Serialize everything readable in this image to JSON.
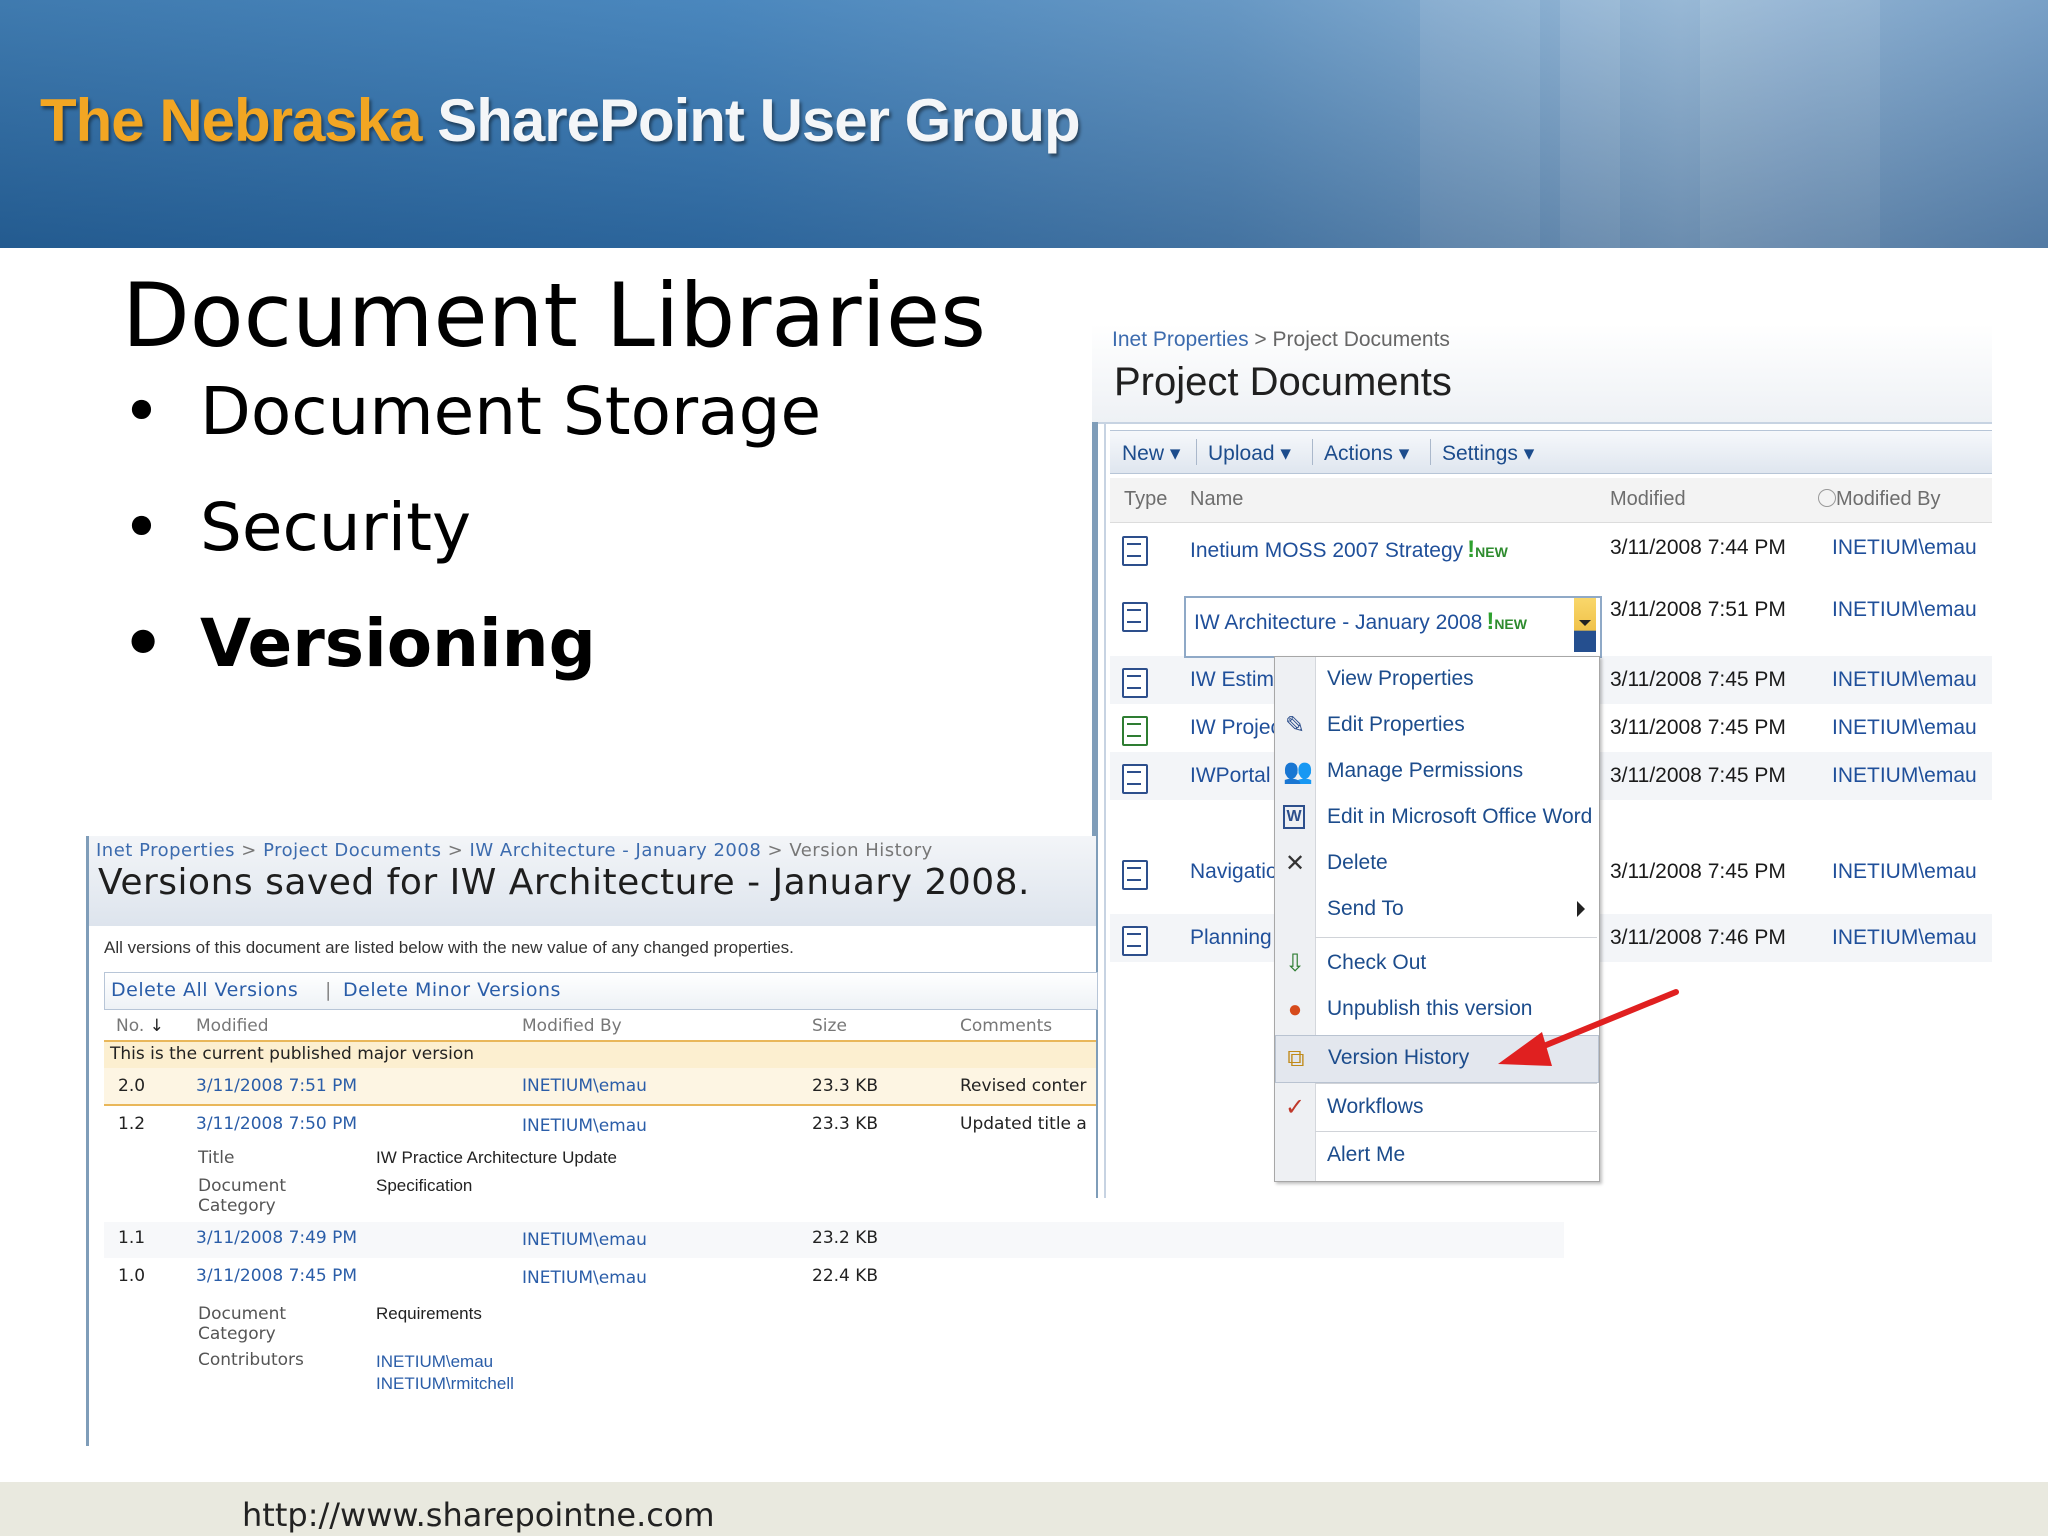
{
  "banner": {
    "title_orange": "The Nebraska",
    "title_white": "SharePoint User Group"
  },
  "slide": {
    "title": "Document Libraries",
    "bullets": [
      {
        "text": "Document Storage",
        "bold": false
      },
      {
        "text": "Security",
        "bold": false
      },
      {
        "text": "Versioning",
        "bold": true
      }
    ],
    "bullet_char": "•"
  },
  "library": {
    "breadcrumb": {
      "site": "Inet Properties",
      "sep": " > ",
      "page": "Project Documents"
    },
    "title": "Project Documents",
    "toolbar": [
      "New",
      "Upload",
      "Actions",
      "Settings"
    ],
    "columns": {
      "type": "Type",
      "name": "Name",
      "modified": "Modified",
      "modified_by": "Modified By"
    },
    "new_tag": "NEW",
    "rows": [
      {
        "name": "Inetium MOSS 2007 Strategy",
        "is_new": true,
        "modified": "3/11/2008 7:44 PM",
        "modified_by": "INETIUM\\emau",
        "icon": "word-doc-icon"
      },
      {
        "name": "IW Architecture - January 2008",
        "is_new": true,
        "modified": "3/11/2008 7:51 PM",
        "modified_by": "INETIUM\\emau",
        "icon": "word-doc-icon"
      },
      {
        "name": "IW Estima",
        "modified": "3/11/2008 7:45 PM",
        "modified_by": "INETIUM\\emau",
        "icon": "word-doc-icon"
      },
      {
        "name": "IW Projec",
        "modified": "3/11/2008 7:45 PM",
        "modified_by": "INETIUM\\emau",
        "icon": "excel-doc-icon"
      },
      {
        "name": "IWPortal",
        "modified": "3/11/2008 7:45 PM",
        "modified_by": "INETIUM\\emau",
        "icon": "word-doc-icon"
      },
      {
        "name": "Navigatior",
        "modified": "3/11/2008 7:45 PM",
        "modified_by": "INETIUM\\emau",
        "icon": "word-doc-icon"
      },
      {
        "name": "Planning A",
        "modified": "3/11/2008 7:46 PM",
        "modified_by": "INETIUM\\emau",
        "icon": "word-doc-icon"
      }
    ],
    "menu": [
      {
        "label": "View Properties",
        "icon": ""
      },
      {
        "label": "Edit Properties",
        "icon": "edit-properties-icon"
      },
      {
        "label": "Manage Permissions",
        "icon": "manage-permissions-icon"
      },
      {
        "label": "Edit in Microsoft Office Word",
        "icon": "word-icon"
      },
      {
        "label": "Delete",
        "icon": "delete-x-icon"
      },
      {
        "label": "Send To",
        "icon": "",
        "submenu": true
      },
      {
        "label": "Check Out",
        "icon": "check-out-icon"
      },
      {
        "label": "Unpublish this version",
        "icon": "unpublish-icon"
      },
      {
        "label": "Version History",
        "icon": "version-history-icon",
        "highlighted": true
      },
      {
        "label": "Workflows",
        "icon": "workflows-icon"
      },
      {
        "label": "Alert Me",
        "icon": ""
      }
    ]
  },
  "versions": {
    "breadcrumb": [
      "Inet Properties",
      "Project Documents",
      "IW Architecture - January 2008",
      "Version History"
    ],
    "crumb_sep": " > ",
    "title": "Versions saved for IW Architecture - January 2008.",
    "description": "All versions of this document are listed below with the new value of any changed properties.",
    "toolbar": {
      "delete_all": "Delete All Versions",
      "sep": "|",
      "delete_minor": "Delete Minor Versions"
    },
    "columns": {
      "no": "No.",
      "sort": "↓",
      "modified": "Modified",
      "modified_by": "Modified By",
      "size": "Size",
      "comments": "Comments"
    },
    "current_note": "This is the current published major version",
    "rows": [
      {
        "no": "2.0",
        "modified": "3/11/2008 7:51 PM",
        "modified_by": "INETIUM\\emau",
        "size": "23.3 KB",
        "comments": "Revised conter"
      },
      {
        "no": "1.2",
        "modified": "3/11/2008 7:50 PM",
        "modified_by": "INETIUM\\emau",
        "size": "23.3 KB",
        "comments": "Updated title a"
      },
      {
        "no": "1.1",
        "modified": "3/11/2008 7:49 PM",
        "modified_by": "INETIUM\\emau",
        "size": "23.2 KB",
        "comments": ""
      },
      {
        "no": "1.0",
        "modified": "3/11/2008 7:45 PM",
        "modified_by": "INETIUM\\emau",
        "size": "22.4 KB",
        "comments": ""
      }
    ],
    "props_12": [
      {
        "label": "Title",
        "value": "IW Practice Architecture Update"
      },
      {
        "label": "Document Category",
        "value": "Specification"
      }
    ],
    "props_10": [
      {
        "label": "Document Category",
        "value": "Requirements"
      },
      {
        "label": "Contributors",
        "value": "INETIUM\\emau",
        "value2": "INETIUM\\rmitchell"
      }
    ]
  },
  "footer": {
    "url": "http://www.sharepointne.com"
  }
}
